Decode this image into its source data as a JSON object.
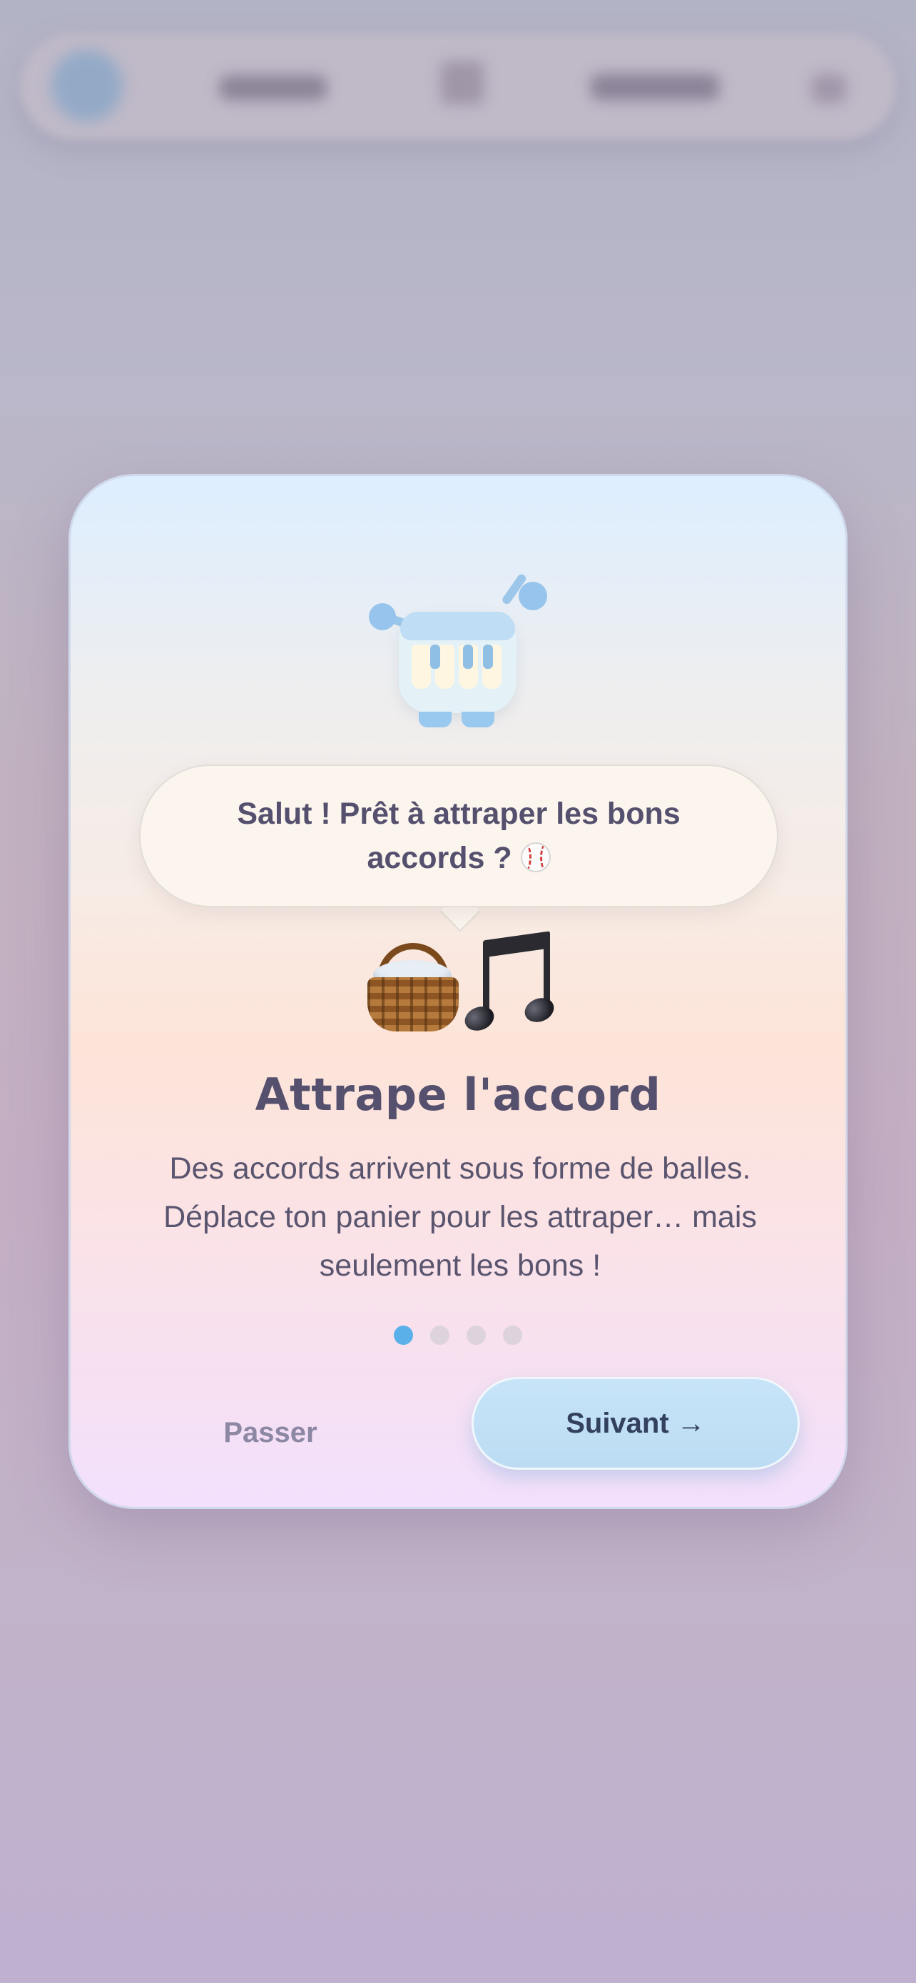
{
  "background_bar": {
    "icons": [
      "avatar-icon",
      "filter-icon",
      "more-icon"
    ]
  },
  "onboarding": {
    "mascot_icon": "piano-robot-icon",
    "speech": {
      "text": "Salut ! Prêt à attraper les bons accords ?",
      "trailing_icon": "baseball-icon"
    },
    "illustration_icons": [
      "basket-icon",
      "music-note-icon"
    ],
    "title": "Attrape l'accord",
    "description": "Des accords arrivent sous forme de balles. Déplace ton panier pour les attraper… mais seulement les bons !",
    "pagination": {
      "current": 1,
      "total": 4
    },
    "skip_label": "Passer",
    "next_label": "Suivant →"
  },
  "colors": {
    "accent": "#5ab1ea",
    "text": "#55506e",
    "button_bg": "#bcdcf3",
    "muted": "#8c87a3"
  }
}
